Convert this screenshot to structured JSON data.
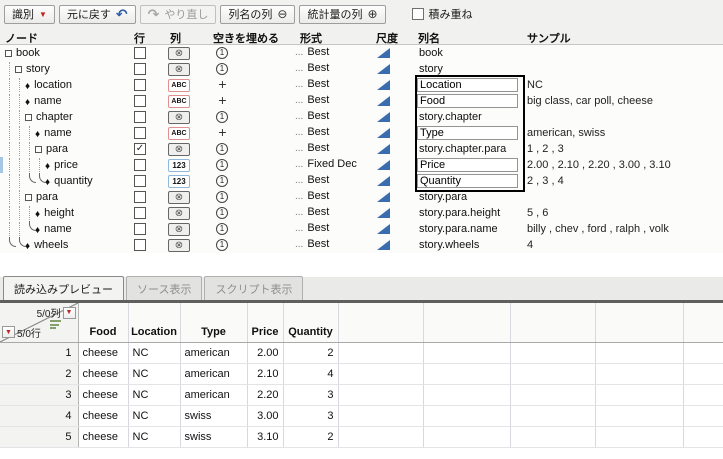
{
  "toolbar": {
    "buttons": [
      {
        "label": "識別",
        "icon": "red-triangle-down"
      },
      {
        "label": "元に戻す",
        "icon": "undo-arrow"
      },
      {
        "label": "やり直し",
        "icon": "redo-arrow",
        "disabled": true
      },
      {
        "label": "列名の列",
        "icon": "minus-circle"
      },
      {
        "label": "統計量の列",
        "icon": "plus-circle"
      }
    ],
    "stack_label": "積み重ね",
    "stack_checked": false
  },
  "tree": {
    "headers": {
      "node": "ノード",
      "row": "行",
      "col": "列",
      "fill": "空きを埋める",
      "format": "形式",
      "scale": "尺度",
      "colname": "列名",
      "sample": "サンプル"
    },
    "format_ellipsis": "...",
    "accent_colors": {
      "scale_triangle": "#3a6db0",
      "abc_border": "#e09090",
      "num_border": "#8fb8dc"
    },
    "rows": [
      {
        "name": "book",
        "node_icon": "container",
        "check": "",
        "col_icon": "no-column-icon",
        "fill_icon": "circle-one",
        "format": "Best",
        "colname": "book",
        "colname_editable": false,
        "sample": ""
      },
      {
        "name": "story",
        "node_icon": "container",
        "check": "",
        "col_icon": "no-column-icon",
        "fill_icon": "circle-one",
        "format": "Best",
        "colname": "story",
        "colname_editable": false,
        "sample": ""
      },
      {
        "name": "location",
        "node_icon": "leaf",
        "check": "",
        "col_icon": "abc-column-icon",
        "fill_icon": "plus",
        "format": "Best",
        "colname": "Location",
        "colname_editable": true,
        "sample": "NC"
      },
      {
        "name": "name",
        "node_icon": "leaf",
        "check": "",
        "col_icon": "abc-column-icon",
        "fill_icon": "plus",
        "format": "Best",
        "colname": "Food",
        "colname_editable": true,
        "sample": "big class, car poll, cheese"
      },
      {
        "name": "chapter",
        "node_icon": "container",
        "check": "",
        "col_icon": "no-column-icon",
        "fill_icon": "circle-one",
        "format": "Best",
        "colname": "story.chapter",
        "colname_editable": false,
        "sample": ""
      },
      {
        "name": "name",
        "node_icon": "leaf",
        "check": "",
        "col_icon": "abc-column-icon",
        "fill_icon": "plus",
        "format": "Best",
        "colname": "Type",
        "colname_editable": true,
        "sample": "american, swiss"
      },
      {
        "name": "para",
        "node_icon": "container",
        "check": "✓",
        "col_icon": "no-column-icon",
        "fill_icon": "circle-one",
        "format": "Best",
        "colname": "story.chapter.para",
        "colname_editable": false,
        "sample": "1 , 2 , 3"
      },
      {
        "name": "price",
        "node_icon": "leaf",
        "check": "",
        "col_icon": "num-column-icon",
        "fill_icon": "circle-one",
        "format": "Fixed Dec",
        "colname": "Price",
        "colname_editable": true,
        "sample": "2.00 , 2.10 , 2.20 , 3.00 , 3.10"
      },
      {
        "name": "quantity",
        "node_icon": "leaf",
        "check": "",
        "col_icon": "num-column-icon",
        "fill_icon": "circle-one",
        "format": "Best",
        "colname": "Quantity",
        "colname_editable": true,
        "sample": "2 , 3 , 4"
      },
      {
        "name": "para",
        "node_icon": "container",
        "check": "",
        "col_icon": "no-column-icon",
        "fill_icon": "circle-one",
        "format": "Best",
        "colname": "story.para",
        "colname_editable": false,
        "sample": ""
      },
      {
        "name": "height",
        "node_icon": "leaf",
        "check": "",
        "col_icon": "no-column-icon",
        "fill_icon": "circle-one",
        "format": "Best",
        "colname": "story.para.height",
        "colname_editable": false,
        "sample": "5 , 6"
      },
      {
        "name": "name",
        "node_icon": "leaf",
        "check": "",
        "col_icon": "no-column-icon",
        "fill_icon": "circle-one",
        "format": "Best",
        "colname": "story.para.name",
        "colname_editable": false,
        "sample": "billy , chev , ford , ralph , volk"
      },
      {
        "name": "wheels",
        "node_icon": "leaf",
        "check": "",
        "col_icon": "no-column-icon",
        "fill_icon": "circle-one",
        "format": "Best",
        "colname": "story.wheels",
        "colname_editable": false,
        "sample": "4"
      }
    ]
  },
  "tabs": [
    {
      "label": "読み込みプレビュー",
      "active": true
    },
    {
      "label": "ソース表示",
      "active": false
    },
    {
      "label": "スクリプト表示",
      "active": false
    }
  ],
  "preview": {
    "corner": {
      "cols": "5/0列",
      "rows": "5/0行"
    },
    "columns": [
      "Food",
      "Location",
      "Type",
      "Price",
      "Quantity"
    ],
    "rows": [
      [
        "1",
        "cheese",
        "NC",
        "american",
        "2.00",
        "2"
      ],
      [
        "2",
        "cheese",
        "NC",
        "american",
        "2.10",
        "4"
      ],
      [
        "3",
        "cheese",
        "NC",
        "american",
        "2.20",
        "3"
      ],
      [
        "4",
        "cheese",
        "NC",
        "swiss",
        "3.00",
        "3"
      ],
      [
        "5",
        "cheese",
        "NC",
        "swiss",
        "3.10",
        "2"
      ]
    ]
  }
}
